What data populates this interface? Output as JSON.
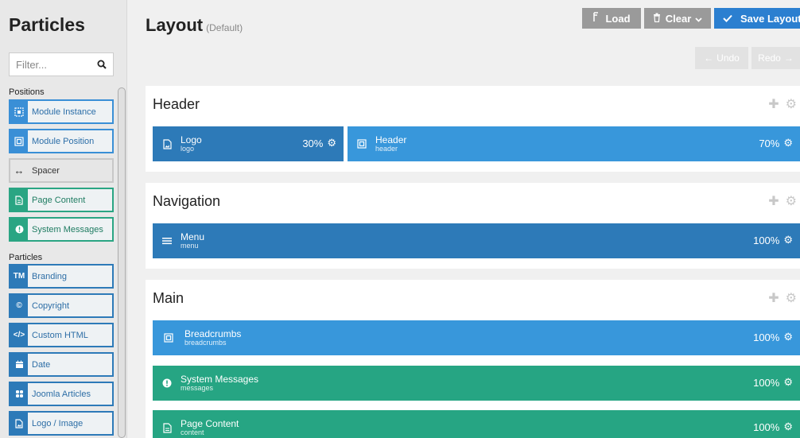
{
  "sidebar": {
    "title": "Particles",
    "filter_placeholder": "Filter...",
    "positions_label": "Positions",
    "particles_label": "Particles",
    "positions": [
      {
        "label": "Module Instance",
        "icon": "module-instance-icon"
      },
      {
        "label": "Module Position",
        "icon": "module-position-icon"
      },
      {
        "label": "Spacer",
        "icon": "spacer-icon"
      },
      {
        "label": "Page Content",
        "icon": "page-content-icon"
      },
      {
        "label": "System Messages",
        "icon": "system-messages-icon"
      }
    ],
    "particles": [
      {
        "label": "Branding",
        "icon_text": "TM"
      },
      {
        "label": "Copyright",
        "icon_text": "©"
      },
      {
        "label": "Custom HTML",
        "icon_text": "</>"
      },
      {
        "label": "Date",
        "icon": "calendar-icon"
      },
      {
        "label": "Joomla Articles",
        "icon": "joomla-icon"
      },
      {
        "label": "Logo / Image",
        "icon": "image-icon"
      }
    ]
  },
  "header": {
    "title": "Layout",
    "subtitle": "(Default)",
    "load_label": "Load",
    "clear_label": "Clear",
    "save_label": "Save Layout",
    "undo_label": "Undo",
    "redo_label": "Redo"
  },
  "sections": {
    "header": {
      "title": "Header",
      "blocks": [
        {
          "name": "Logo",
          "type": "logo",
          "percent": "30%"
        },
        {
          "name": "Header",
          "type": "header",
          "percent": "70%"
        }
      ]
    },
    "navigation": {
      "title": "Navigation",
      "blocks": [
        {
          "name": "Menu",
          "type": "menu",
          "percent": "100%"
        }
      ]
    },
    "main": {
      "title": "Main",
      "blocks": [
        {
          "name": "Breadcrumbs",
          "type": "breadcrumbs",
          "percent": "100%"
        },
        {
          "name": "System Messages",
          "type": "messages",
          "percent": "100%"
        },
        {
          "name": "Page Content",
          "type": "content",
          "percent": "100%"
        }
      ]
    }
  },
  "colors": {
    "dark_blue": "#2d7ab8",
    "light_blue": "#3897db",
    "green": "#26a583",
    "save_blue": "#2b7fd0",
    "button_gray": "#9a9a9a"
  }
}
